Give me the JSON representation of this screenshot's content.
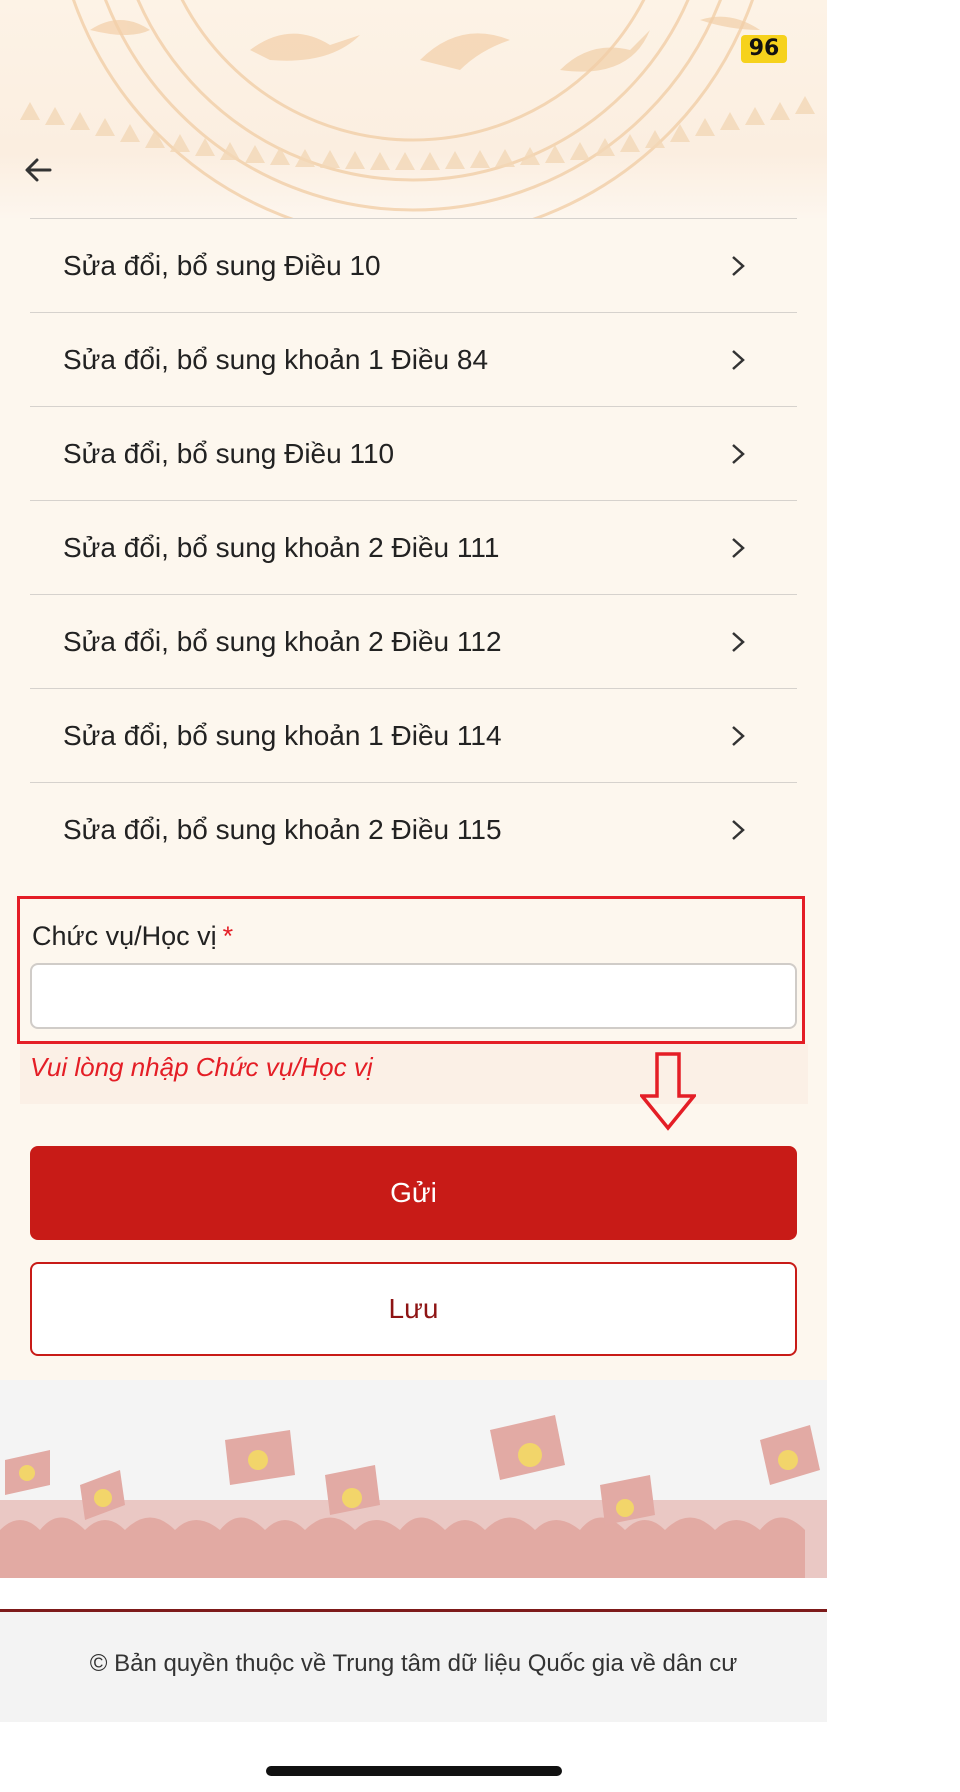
{
  "status": {
    "badge": "96"
  },
  "header": {
    "back_icon": "arrow-left-icon"
  },
  "list": {
    "chevron_icon": "chevron-right-icon",
    "items": [
      {
        "label": "Sửa đổi, bổ sung Điều 10"
      },
      {
        "label": "Sửa đổi, bổ sung khoản 1 Điều 84"
      },
      {
        "label": "Sửa đổi, bổ sung Điều 110"
      },
      {
        "label": "Sửa đổi, bổ sung khoản 2 Điều 111"
      },
      {
        "label": "Sửa đổi, bổ sung khoản 2 Điều 112"
      },
      {
        "label": "Sửa đổi, bổ sung khoản 1 Điều 114"
      },
      {
        "label": "Sửa đổi, bổ sung khoản 2 Điều 115"
      }
    ]
  },
  "form": {
    "position_label": "Chức vụ/Học vị",
    "required_mark": "*",
    "position_value": "",
    "error": "Vui lòng nhập Chức vụ/Học vị"
  },
  "actions": {
    "send_label": "Gửi",
    "save_label": "Lưu"
  },
  "footer": {
    "copyright": "© Bản quyền thuộc về Trung tâm dữ liệu Quốc gia về dân cư"
  },
  "colors": {
    "primary": "#c81b17",
    "error": "#e41e26",
    "panel": "#fdf7ee",
    "badge": "#f6d21c"
  }
}
